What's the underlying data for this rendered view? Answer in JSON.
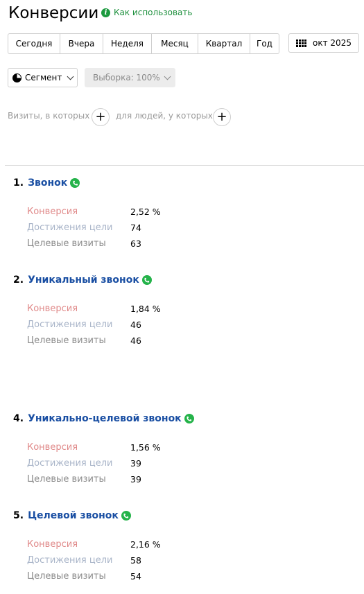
{
  "header": {
    "title": "Конверсии",
    "howto_label": "Как использовать"
  },
  "period": {
    "buttons": [
      "Сегодня",
      "Вчера",
      "Неделя",
      "Месяц",
      "Квартал",
      "Год"
    ],
    "date_label": "окт 2025"
  },
  "controls": {
    "segment_label": "Сегмент",
    "sample_label": "Выборка: 100%"
  },
  "filters": {
    "visits_label": "Визиты, в которых",
    "people_label": "для людей, у которых",
    "plus": "+"
  },
  "metric_labels": {
    "conversion": "Конверсия",
    "reaches": "Достижения цели",
    "visits": "Целевые визиты"
  },
  "goals": [
    {
      "num": "1.",
      "name": "Звонок",
      "conversion": "2,52 %",
      "reaches": "74",
      "visits": "63"
    },
    {
      "num": "2.",
      "name": "Уникальный звонок",
      "conversion": "1,84 %",
      "reaches": "46",
      "visits": "46"
    },
    {
      "num": "4.",
      "name": "Уникально-целевой звонок",
      "conversion": "1,56 %",
      "reaches": "39",
      "visits": "39"
    },
    {
      "num": "5.",
      "name": "Целевой звонок",
      "conversion": "2,16 %",
      "reaches": "58",
      "visits": "54"
    }
  ],
  "colors": {
    "accent_green": "#1c8f3c",
    "goal_link": "#1a4fa3",
    "conversion_label": "#e08a8a",
    "reaches_label": "#a8b4c8",
    "visits_label": "#8a8a8a",
    "phone_icon": "#25b34a"
  },
  "icons": {
    "howto": "info-icon",
    "date": "calendar-icon",
    "segment": "pie-chart-icon",
    "goal": "phone-icon"
  }
}
